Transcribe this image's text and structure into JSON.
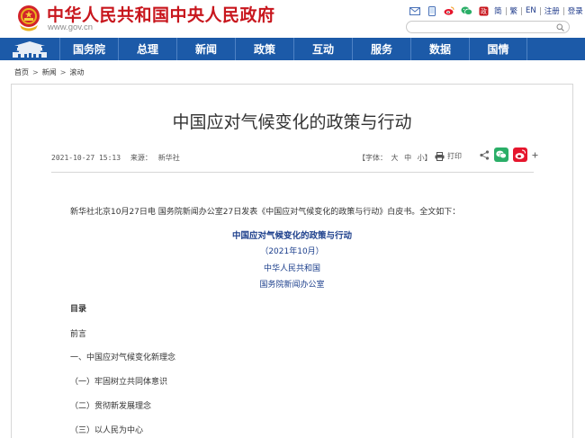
{
  "site": {
    "title": "中华人民共和国中央人民政府",
    "url": "www.gov.cn"
  },
  "top_links": [
    "简",
    "繁",
    "EN",
    "注册",
    "登录"
  ],
  "search": {
    "placeholder": ""
  },
  "nav": {
    "items": [
      "国务院",
      "总理",
      "新闻",
      "政策",
      "互动",
      "服务",
      "数据",
      "国情"
    ]
  },
  "breadcrumb": [
    "首页",
    "新闻",
    "滚动"
  ],
  "article": {
    "title": "中国应对气候变化的政策与行动",
    "date": "2021-10-27 15:13",
    "source_label": "来源：",
    "source": "新华社",
    "font_label": "【字体：",
    "font_large": "大",
    "font_medium": "中",
    "font_small": "小】",
    "print_label": "打印",
    "intro": "新华社北京10月27日电  国务院新闻办公室27日发表《中国应对气候变化的政策与行动》白皮书。全文如下：",
    "doc_title": "中国应对气候变化的政策与行动",
    "doc_date": "（2021年10月）",
    "doc_issuer1": "中华人民共和国",
    "doc_issuer2": "国务院新闻办公室",
    "toc_label": "目录",
    "toc_items": [
      "前言",
      "一、中国应对气候变化新理念",
      "（一）牢固树立共同体意识",
      "（二）贯彻新发展理念",
      "（三）以人民为中心"
    ]
  },
  "colors": {
    "brand_red": "#c8161d",
    "nav_blue": "#1c5aa8",
    "doc_blue": "#1c3f8c"
  }
}
